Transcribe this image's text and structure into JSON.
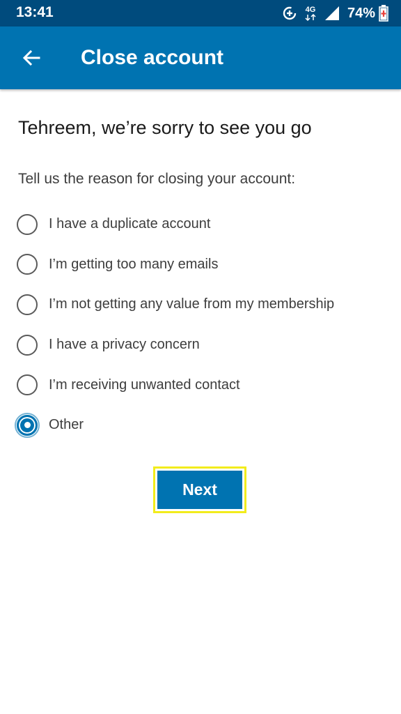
{
  "status_bar": {
    "time": "13:41",
    "network_type": "4G",
    "battery_percent": "74%",
    "icons": [
      "data-saver-icon",
      "network-4g-icon",
      "signal-icon",
      "battery-icon"
    ]
  },
  "app_bar": {
    "title": "Close account",
    "back_icon": "arrow-left-icon",
    "background_color": "#0073b1"
  },
  "content": {
    "heading": "Tehreem, we’re sorry to see you go",
    "prompt": "Tell us the reason for closing your account:",
    "options": [
      {
        "label": "I have a duplicate account",
        "selected": false
      },
      {
        "label": "I’m getting too many emails",
        "selected": false
      },
      {
        "label": "I’m not getting any value from my membership",
        "selected": false
      },
      {
        "label": "I have a privacy concern",
        "selected": false
      },
      {
        "label": "I’m receiving unwanted contact",
        "selected": false
      },
      {
        "label": "Other",
        "selected": true
      }
    ],
    "next_label": "Next",
    "accent_color": "#0073b1",
    "highlight_color": "#f2ec1c"
  }
}
